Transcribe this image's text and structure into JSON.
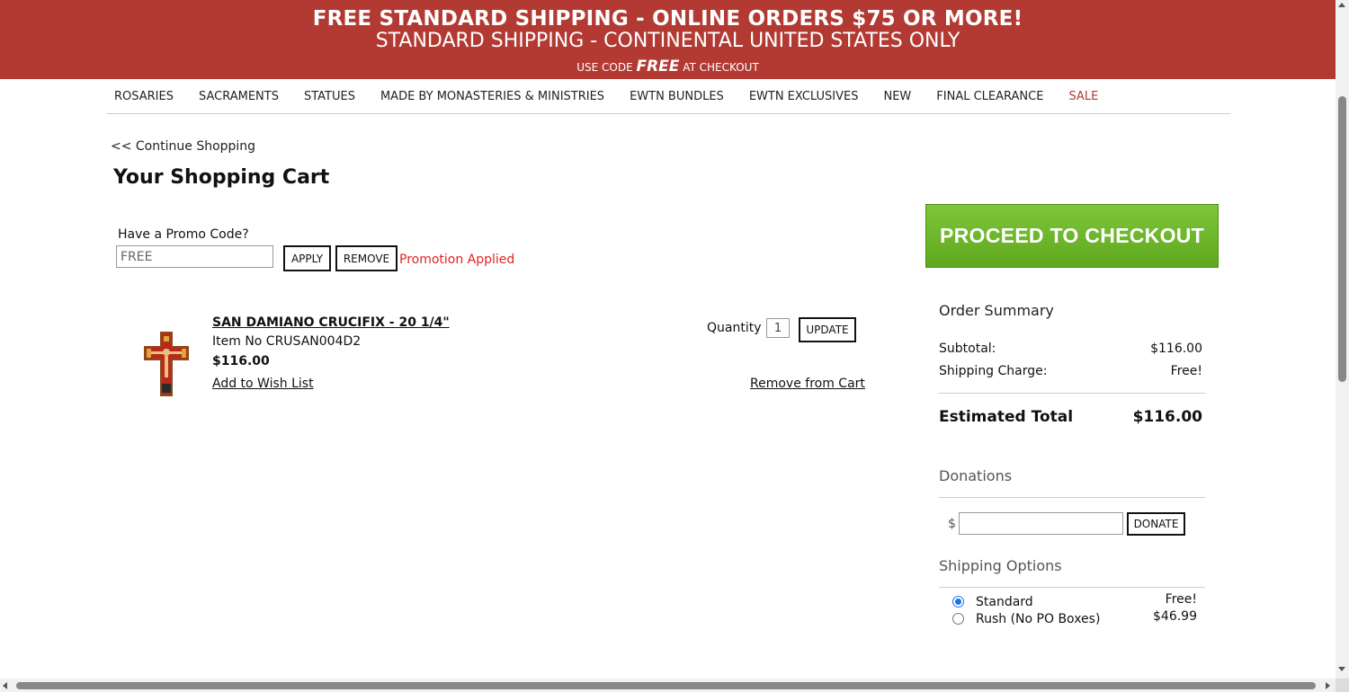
{
  "banner": {
    "line1": "FREE STANDARD SHIPPING - ONLINE ORDERS $75 OR MORE!",
    "line2": "STANDARD SHIPPING - CONTINENTAL UNITED STATES ONLY",
    "line3_prefix": "USE CODE ",
    "line3_code": "FREE",
    "line3_suffix": " AT CHECKOUT",
    "color": "#b23a33"
  },
  "nav": {
    "items": [
      "ROSARIES",
      "SACRAMENTS",
      "STATUES",
      "MADE BY MONASTERIES & MINISTRIES",
      "EWTN BUNDLES",
      "EWTN EXCLUSIVES",
      "NEW",
      "FINAL CLEARANCE",
      "SALE"
    ]
  },
  "continue_shopping": "<< Continue Shopping",
  "page_title": "Your Shopping Cart",
  "promo": {
    "label": "Have a Promo Code?",
    "value": "FREE",
    "apply_label": "APPLY",
    "remove_label": "REMOVE",
    "status": "Promotion Applied"
  },
  "cart_item": {
    "name": "SAN DAMIANO CRUCIFIX - 20 1/4\"",
    "sku": "Item No CRUSAN004D2",
    "price": "$116.00",
    "wishlist_label": "Add to Wish List",
    "quantity_label": "Quantity",
    "quantity": "1",
    "update_label": "UPDATE",
    "remove_label": "Remove from Cart",
    "image_icon": "crucifix-image"
  },
  "checkout_label": "PROCEED TO CHECKOUT",
  "checkout_color": "#6cb52a",
  "summary": {
    "title": "Order Summary",
    "subtotal_label": "Subtotal:",
    "subtotal": "$116.00",
    "shipping_label": "Shipping Charge:",
    "shipping": "Free!",
    "total_label": "Estimated Total",
    "total": "$116.00"
  },
  "donations": {
    "title": "Donations",
    "currency": "$",
    "value": "",
    "button_label": "DONATE"
  },
  "shipping_options": {
    "title": "Shipping Options",
    "options": [
      {
        "label": "Standard",
        "price": "Free!",
        "selected": true
      },
      {
        "label": "Rush (No PO Boxes)",
        "price": "$46.99",
        "selected": false
      }
    ]
  }
}
